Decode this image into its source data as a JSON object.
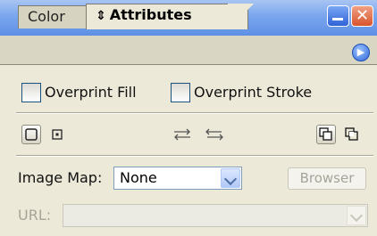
{
  "window": {
    "minimize_icon": "minimize-icon",
    "close_icon": "close-icon"
  },
  "tabs": [
    {
      "label": "Color",
      "active": false
    },
    {
      "label": "Attributes",
      "active": true
    }
  ],
  "panel_menu_icon": "panel-menu-arrow-icon",
  "checkboxes": {
    "overprint_fill": {
      "label": "Overprint Fill",
      "checked": false
    },
    "overprint_stroke": {
      "label": "Overprint Stroke",
      "checked": false
    }
  },
  "toolbar_icons": {
    "show_center_point_off": "center-point-off-icon",
    "show_center_point_on": "center-point-on-icon",
    "reverse_path_direction": "reverse-path-direction-icon",
    "swap_direction": "swap-direction-icon",
    "fill_rule_nonzero": "nonzero-winding-icon",
    "fill_rule_evenodd": "even-odd-icon"
  },
  "image_map": {
    "label": "Image Map:",
    "value": "None",
    "browser_button": "Browser"
  },
  "url": {
    "label": "URL:",
    "value": ""
  },
  "colors": {
    "panel_bg": "#ece9d8",
    "title_blue": "#5e8fe4",
    "close_red": "#d8542c"
  }
}
